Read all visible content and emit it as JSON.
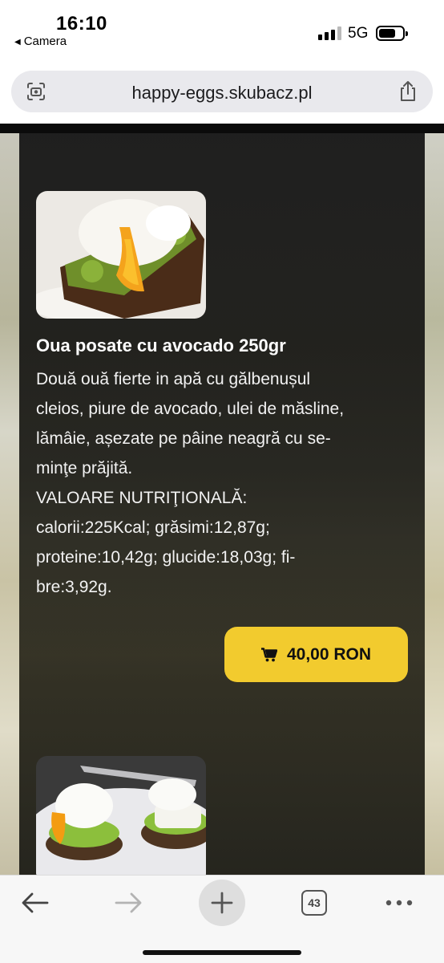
{
  "status_bar": {
    "time": "16:10",
    "back_app": "Camera",
    "network": "5G",
    "signal_bars_active": 3,
    "signal_bars_total": 4,
    "battery_level": 0.65
  },
  "browser": {
    "url": "happy-eggs.skubacz.pl",
    "left_icon": "camera-scan-icon",
    "right_icon": "share-icon"
  },
  "product": {
    "title": "Oua posate cu avocado 250gr",
    "description_lines": [
      "Două ouă fierte in apă cu gălbenușul",
      "cleios, piure de avocado, ulei de măsline,",
      "lămâie, așezate pe pâine neagră cu se-",
      "minţe prăjită.",
      "VALOARE NUTRIŢIONALĂ:",
      "calorii:225Kcal; grăsimi:12,87g;",
      "proteine:10,42g; glucide:18,03g; fi-",
      "bre:3,92g."
    ],
    "price": "40,00 RON",
    "price_icon": "cart-icon",
    "image_icon": "food-photo-icon"
  },
  "toolbar": {
    "back_icon": "arrow-left-icon",
    "forward_icon": "arrow-right-icon",
    "new_tab_icon": "plus-icon",
    "tab_count": "43",
    "more_icon": "ellipsis-icon"
  },
  "colors": {
    "accent": "#f2cb2e",
    "card_bg": "#161616",
    "url_bar_bg": "#e9e9ed"
  }
}
